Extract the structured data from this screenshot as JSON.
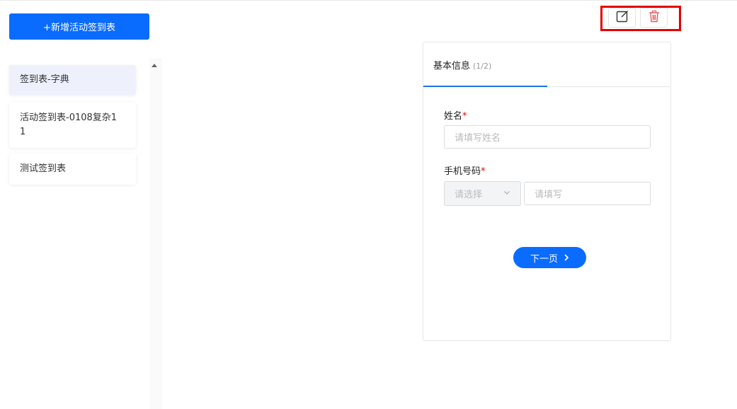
{
  "sidebar": {
    "add_button_label": "+新增活动签到表",
    "items": [
      {
        "label": "签到表-字典"
      },
      {
        "label": "活动签到表-0108复杂11"
      },
      {
        "label": "测试签到表"
      }
    ]
  },
  "toolbar": {
    "edit_icon": "edit-icon",
    "delete_icon": "trash-icon",
    "delete_color": "#e85c5c"
  },
  "form": {
    "tab_title": "基本信息",
    "tab_count": "(1/2)",
    "fields": {
      "name": {
        "label": "姓名",
        "required_mark": "*",
        "placeholder": "请填写姓名"
      },
      "phone": {
        "label": "手机号码",
        "required_mark": "*",
        "select_placeholder": "请选择",
        "placeholder": "请填写"
      }
    },
    "next_button_label": "下一页"
  },
  "colors": {
    "primary": "#0a6cff",
    "required": "#e60000",
    "highlight": "#e60000"
  }
}
